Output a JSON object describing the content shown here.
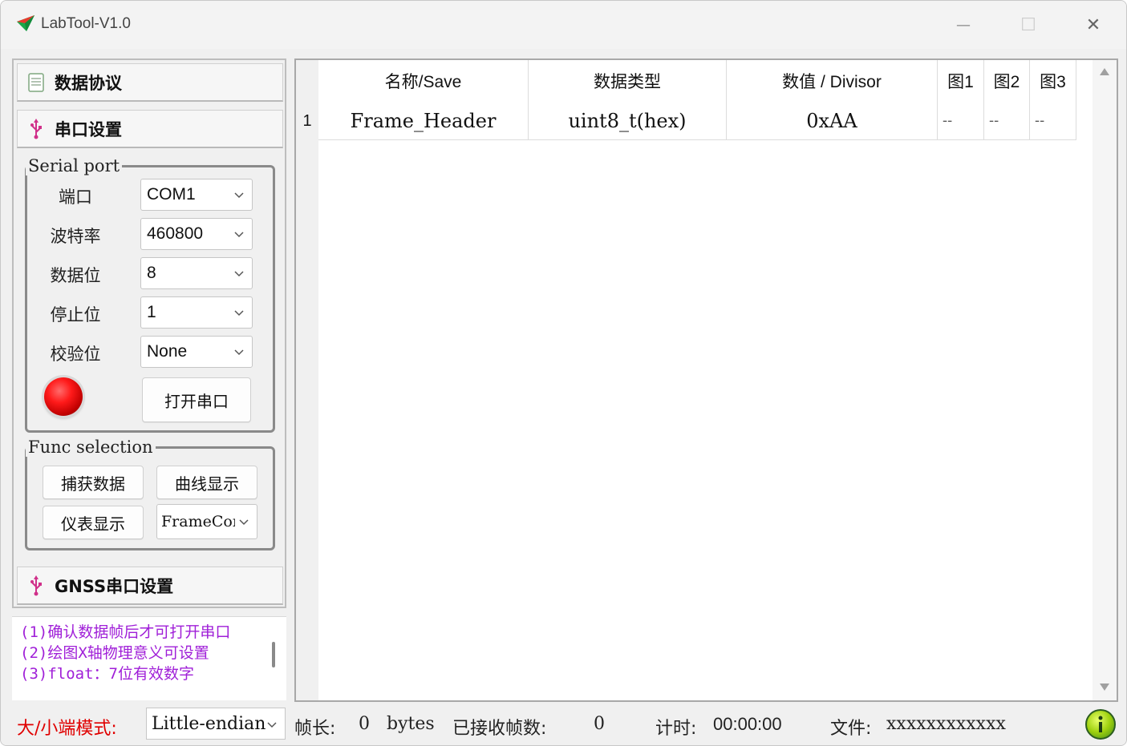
{
  "window": {
    "title": "LabTool-V1.0",
    "minimize_glyph": "—",
    "maximize_glyph": "☐",
    "close_glyph": "✕"
  },
  "left_panel": {
    "protocol_header": "数据协议",
    "serial_header": "串口设置",
    "gnss_header": "GNSS串口设置",
    "serial_port_group": {
      "title": "Serial port",
      "fields": [
        {
          "label": "端口",
          "value": "COM1"
        },
        {
          "label": "波特率",
          "value": "460800"
        },
        {
          "label": "数据位",
          "value": "8"
        },
        {
          "label": "停止位",
          "value": "1"
        },
        {
          "label": "校验位",
          "value": "None"
        }
      ],
      "open_button": "打开串口",
      "status_led_color": "#ff1a1a"
    },
    "func_group": {
      "title": "Func selection",
      "capture_button": "捕获数据",
      "curve_button": "曲线显示",
      "gauge_button": "仪表显示",
      "frame_combo": "FrameCoı"
    }
  },
  "hints": {
    "line1": "(1)确认数据帧后才可打开串口",
    "line2": "(2)绘图X轴物理意义可设置",
    "line3": "(3)float：7位有效数字"
  },
  "table": {
    "headers": [
      "名称/Save",
      "数据类型",
      "数值 / Divisor",
      "图1",
      "图2",
      "图3"
    ],
    "rows": [
      {
        "index": "1",
        "name": "Frame_Header",
        "type": "uint8_t(hex)",
        "value": "0xAA",
        "fig1": "--",
        "fig2": "--",
        "fig3": "--"
      }
    ]
  },
  "status_bar": {
    "endian_label": "大/小端模式:",
    "endian_value": "Little-endian",
    "frame_len_label": "帧长:",
    "frame_len_value": "0",
    "frame_len_unit": "bytes",
    "received_label": "已接收帧数:",
    "received_value": "0",
    "timer_label": "计时:",
    "timer_value": "00:00:00",
    "file_label": "文件:",
    "file_value": "xxxxxxxxxxxx"
  },
  "colors": {
    "hint_text": "#a020d8",
    "endian_label": "#e00000",
    "usb_icon": "#d0308a"
  },
  "icons": [
    "app-logo-icon",
    "document-icon",
    "usb-icon",
    "chevron-down-icon",
    "info-icon"
  ]
}
